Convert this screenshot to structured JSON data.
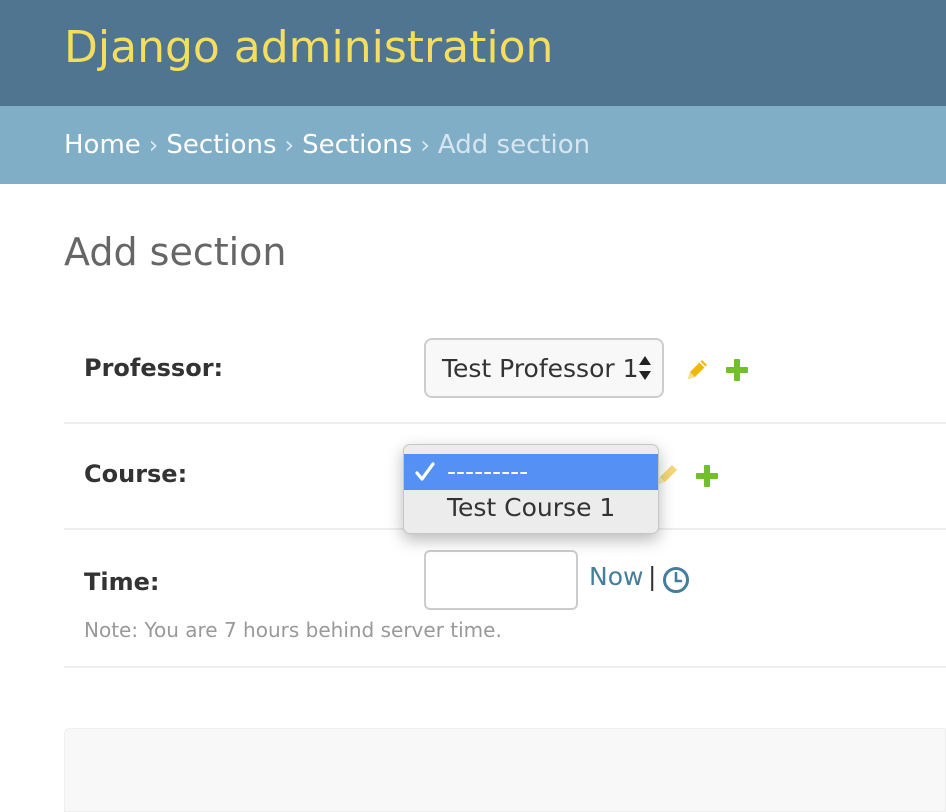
{
  "header": {
    "site_title": "Django administration",
    "title_color": "#f5dd5d",
    "background": "#4f7590"
  },
  "breadcrumbs": {
    "items": [
      "Home",
      "Sections",
      "Sections"
    ],
    "separator": "›",
    "current": "Add section"
  },
  "page": {
    "title": "Add section"
  },
  "form": {
    "professor": {
      "label": "Professor:",
      "selected": "Test Professor 1",
      "edit_icon": "pencil-icon",
      "add_icon": "plus-icon"
    },
    "course": {
      "label": "Course:",
      "edit_icon": "pencil-icon",
      "add_icon": "plus-icon",
      "dropdown": {
        "options": [
          "---------",
          "Test Course 1"
        ],
        "selected_index": 0,
        "highlight_color": "#5591f5"
      }
    },
    "time": {
      "label": "Time:",
      "value": "",
      "now_link": "Now",
      "separator": "|",
      "clock_icon": "clock-icon",
      "note": "Note: You are 7 hours behind server time."
    }
  },
  "colors": {
    "link": "#447e9b",
    "add_green": "#70bf2b",
    "edit_yellow": "#efb80b"
  }
}
